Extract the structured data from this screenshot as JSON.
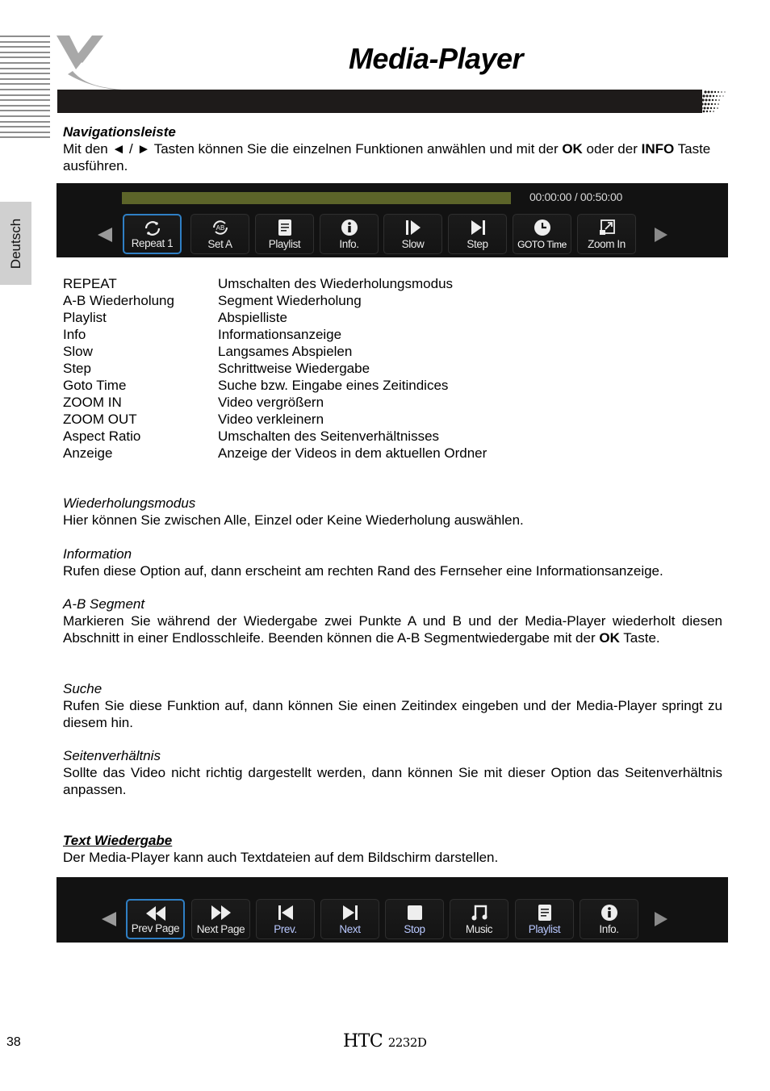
{
  "page": {
    "title": "Media-Player",
    "language_tab": "Deutsch",
    "page_number": "38",
    "model": {
      "prefix": "HTC",
      "number": "2232D"
    }
  },
  "nav_section": {
    "heading": "Navigationsleiste",
    "text_1": "Mit den ◄ / ► Tasten können Sie die einzelnen Funktionen anwählen und mit der ",
    "bold_1": "OK",
    "text_2": " oder der ",
    "bold_2": "INFO",
    "text_3": " Taste ausführen."
  },
  "video_player": {
    "progress_fraction": 1.0,
    "time_current": "00:00:00",
    "time_separator": " / ",
    "time_total": "00:50:00",
    "buttons": [
      {
        "label": "Repeat 1",
        "icon": "repeat-icon",
        "active": true
      },
      {
        "label": "Set A",
        "icon": "ab-repeat-icon",
        "active": false
      },
      {
        "label": "Playlist",
        "icon": "playlist-icon",
        "active": false
      },
      {
        "label": "Info.",
        "icon": "info-icon",
        "active": false
      },
      {
        "label": "Slow",
        "icon": "slow-icon",
        "active": false
      },
      {
        "label": "Step",
        "icon": "step-icon",
        "active": false
      },
      {
        "label": "GOTO Time",
        "icon": "clock-icon",
        "active": false
      },
      {
        "label": "Zoom In",
        "icon": "zoom-in-icon",
        "active": false
      }
    ]
  },
  "functions": [
    {
      "name": "REPEAT",
      "desc": "Umschalten des Wiederholungsmodus"
    },
    {
      "name": "A-B Wiederholung",
      "desc": "Segment Wiederholung"
    },
    {
      "name": "Playlist",
      "desc": "Abspielliste"
    },
    {
      "name": "Info",
      "desc": "Informationsanzeige"
    },
    {
      "name": "Slow",
      "desc": "Langsames Abspielen"
    },
    {
      "name": "Step",
      "desc": "Schrittweise Wiedergabe"
    },
    {
      "name": "Goto Time",
      "desc": "Suche bzw. Eingabe eines Zeitindices"
    },
    {
      "name": "ZOOM IN",
      "desc": "Video vergrößern"
    },
    {
      "name": "ZOOM OUT",
      "desc": "Video verkleinern"
    },
    {
      "name": "Aspect Ratio",
      "desc": "Umschalten des Seitenverhältnisses"
    },
    {
      "name": "Anzeige",
      "desc": "Anzeige der Videos in dem aktuellen Ordner"
    }
  ],
  "sections": {
    "repeat": {
      "heading": "Wiederholungsmodus",
      "text": "Hier können Sie zwischen Alle, Einzel oder Keine Wiederholung auswählen."
    },
    "info": {
      "heading": "Information",
      "text": "Rufen diese Option auf, dann erscheint am rechten Rand des Fernseher eine Informationsanzeige."
    },
    "ab": {
      "heading": "A-B Segment",
      "text": "Markieren Sie während der Wiedergabe zwei Punkte A und B und der Media-Player wiederholt die­sen Abschnitt in einer Endlosschleife. Beenden können die A-B Segmentwiedergabe mit der ",
      "bold": "OK",
      "text_end": " Taste."
    },
    "search": {
      "heading": "Suche",
      "text": "Rufen Sie diese Funktion auf, dann können Sie einen Zeitindex eingeben und der Media-Player springt zu diesem hin."
    },
    "aspect": {
      "heading": "Seitenverhältnis",
      "text": "Sollte das Video nicht richtig dargestellt werden, dann können Sie mit dieser Option das Seitenver­hältnis anpassen."
    },
    "text_playback": {
      "heading": "Text Wiedergabe",
      "text": "Der Media-Player kann auch Textdateien auf dem Bildschirm darstellen."
    }
  },
  "text_player": {
    "buttons": [
      {
        "label": "Prev Page",
        "icon": "prev-page-icon",
        "active": true
      },
      {
        "label": "Next Page",
        "icon": "next-page-icon",
        "active": false
      },
      {
        "label": "Prev.",
        "icon": "previous-icon",
        "active": false
      },
      {
        "label": "Next",
        "icon": "next-icon",
        "active": false
      },
      {
        "label": "Stop",
        "icon": "stop-icon",
        "active": false
      },
      {
        "label": "Music",
        "icon": "music-icon",
        "active": false
      },
      {
        "label": "Playlist",
        "icon": "playlist-icon",
        "active": false
      },
      {
        "label": "Info.",
        "icon": "info-icon",
        "active": false
      }
    ]
  },
  "colors": {
    "accent_blue": "#2f7fc4",
    "progress": "#5c6429",
    "header_bar": "#1e1b1a"
  }
}
